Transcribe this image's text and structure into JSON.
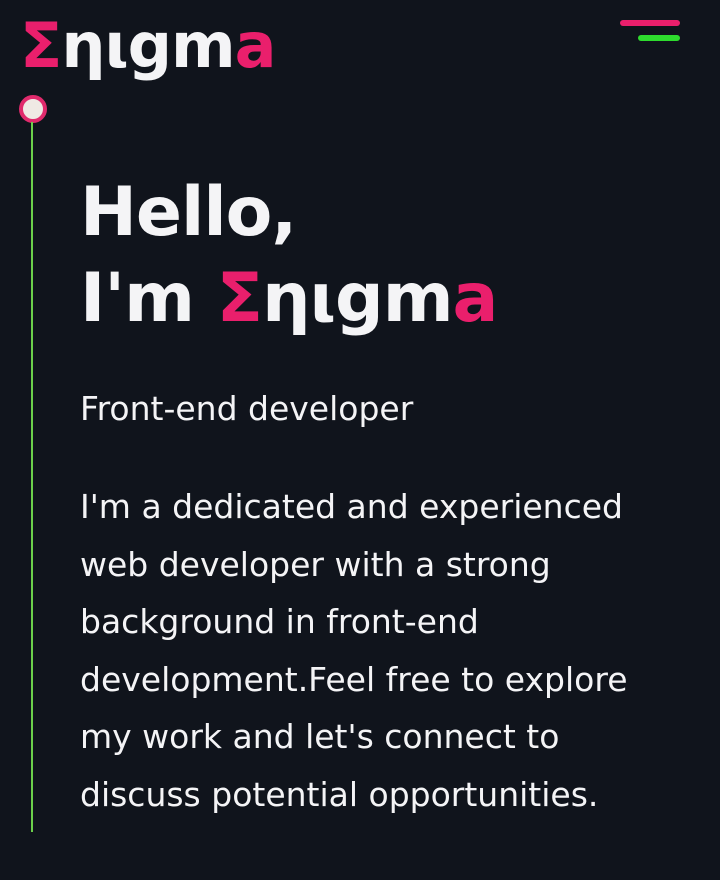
{
  "header": {
    "logo": {
      "part1": "Σηιgm",
      "part2": "a"
    },
    "menu_icon": "hamburger-menu-icon"
  },
  "hero": {
    "greeting_line1": "Hello,",
    "greeting_line2_prefix": "I'm ",
    "name_part1": "Σηιgm",
    "name_part2": "a",
    "role": "Front-end developer",
    "bio_lines": [
      "I'm a dedicated and experienced",
      "web developer with a strong",
      "background in front-end",
      "development.Feel free to explore",
      "my work and let's connect to",
      "discuss potential opportunities."
    ]
  },
  "colors": {
    "background": "#10141c",
    "accent_pink": "#ea1f6c",
    "accent_green": "#2edb2e",
    "timeline_green": "#6cd04b",
    "text": "#f4f4f6"
  }
}
